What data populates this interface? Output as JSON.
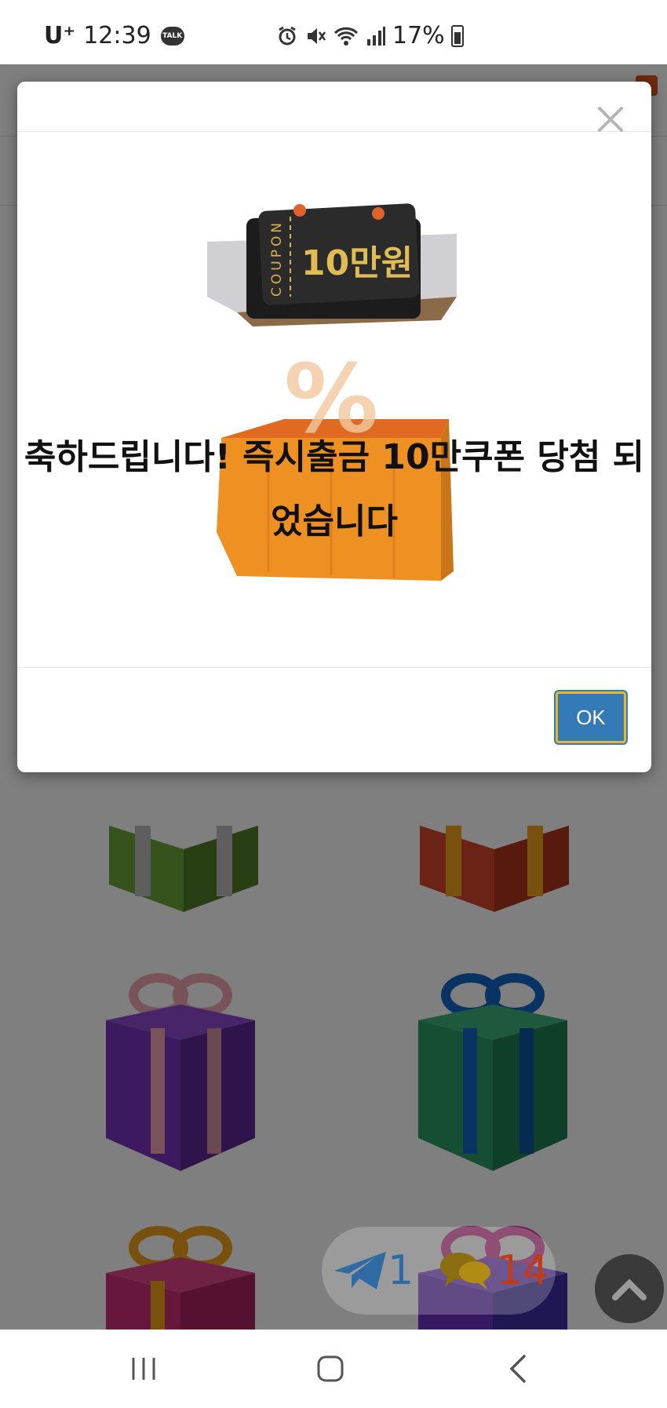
{
  "status_bar": {
    "carrier": "U⁺",
    "time": "12:39",
    "talk_icon_label": "TALK",
    "battery": "17%",
    "icons": [
      "kakaotalk-icon",
      "alarm-icon",
      "mute-icon",
      "wifi-icon",
      "signal-icon",
      "battery-icon"
    ]
  },
  "modal": {
    "coupon_side": "COUPON",
    "coupon_amount": "10만원",
    "message": "축하드립니다! 즉시출금 10만쿠폰 당첨 되었습니다",
    "ok_label": "OK",
    "close_icon": "close-icon"
  },
  "widgets": {
    "telegram_count": "1",
    "chat_count": "14",
    "scroll_top_icon": "chevron-up-icon"
  },
  "navbar": {
    "icons": [
      "recent-apps-icon",
      "home-icon",
      "back-icon"
    ]
  },
  "colors": {
    "ok_button": "#337ab7",
    "ok_border": "#e8b62a",
    "overlay": "rgba(0,0,0,0.5)",
    "telegram": "#2f6aa3",
    "chat_count": "#c43a16"
  }
}
